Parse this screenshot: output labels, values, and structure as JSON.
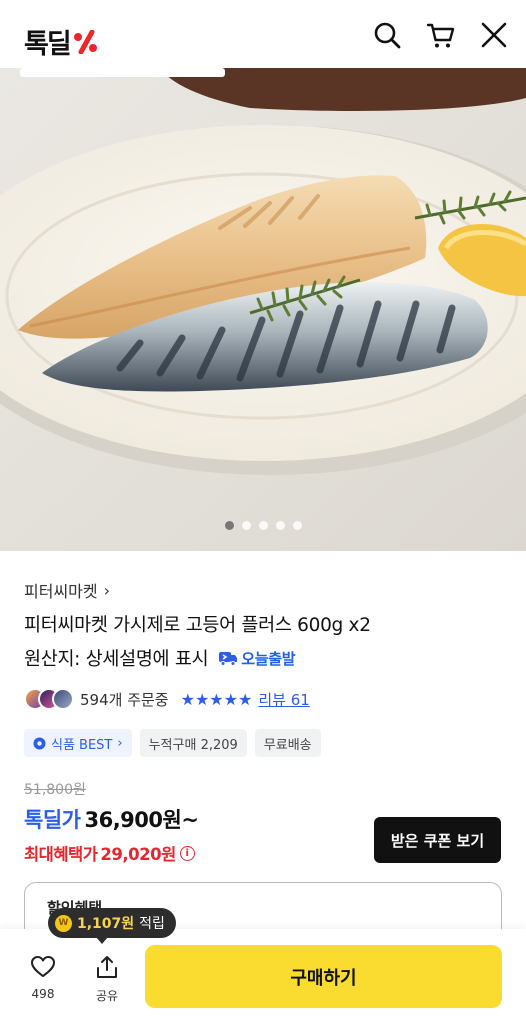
{
  "header": {
    "logo_text": "톡딜",
    "logo_icon": "percent-mark-icon",
    "search_icon": "search-icon",
    "cart_icon": "cart-icon",
    "close_icon": "close-icon"
  },
  "gallery": {
    "image_alt": "product photo",
    "page_count": 5,
    "active_index": 0
  },
  "product": {
    "brand": "피터씨마켓",
    "brand_chevron": "›",
    "title": "피터씨마켓 가시제로 고등어 플러스 600g x2",
    "origin": "원산지: 상세설명에 표시",
    "today_ship": "오늘출발",
    "orders": "594개 주문중",
    "stars": "★★★★★",
    "reviews": "리뷰 61"
  },
  "chips": {
    "best": "식품 BEST",
    "best_chevron": "›",
    "cumulative": "누적구매 2,209",
    "shipping": "무료배송"
  },
  "price": {
    "original": "51,800원",
    "label": "톡딜가",
    "value": "36,900원~",
    "max_label": "최대혜택가",
    "max_value": "29,020원",
    "info_glyph": "i",
    "coupon_button": "받은 쿠폰 보기"
  },
  "benefit": {
    "title": "할인혜택"
  },
  "bottom": {
    "points_coin": "W",
    "points_value": "1,107원",
    "points_text": "적립",
    "like_count": "498",
    "share_label": "공유",
    "buy_label": "구매하기"
  },
  "colors": {
    "accent_blue": "#2c5ee8",
    "sale_red": "#e6262f",
    "buy_yellow": "#f9dc2f",
    "logo_red": "#f0242b"
  }
}
